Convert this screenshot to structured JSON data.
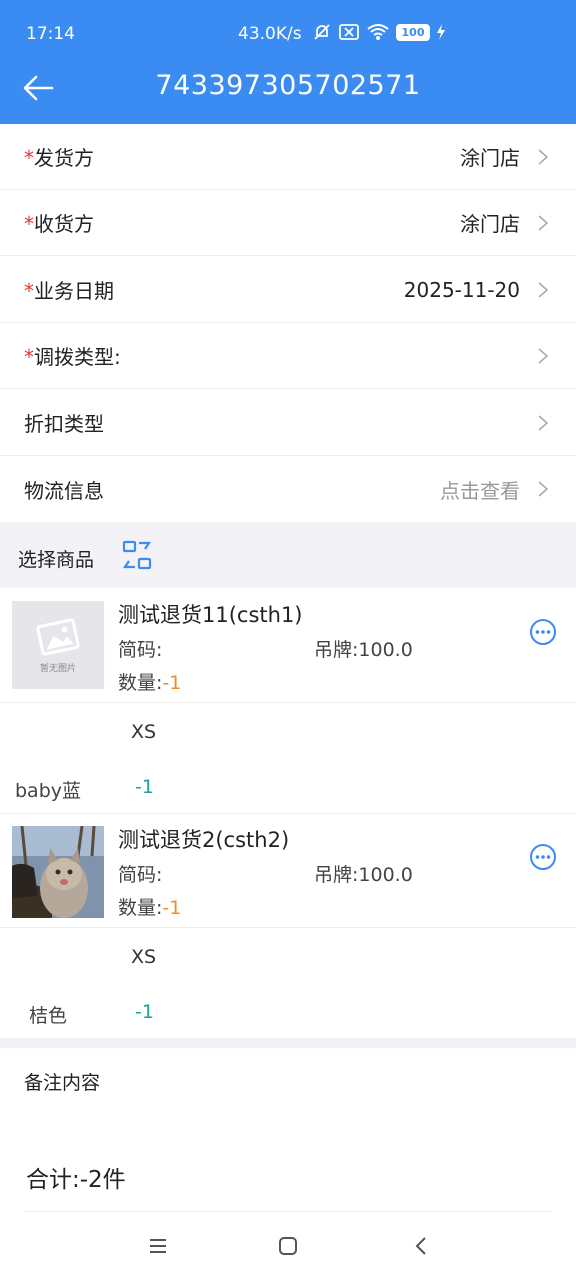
{
  "status_bar": {
    "time": "17:14",
    "net_speed": "43.0K/s",
    "battery": "100"
  },
  "header": {
    "title": "743397305702571"
  },
  "form": {
    "sender": {
      "label": "发货方",
      "value": "涂门店"
    },
    "receiver": {
      "label": "收货方",
      "value": "涂门店"
    },
    "biz_date": {
      "label": "业务日期",
      "value": "2025-11-20"
    },
    "transfer_type": {
      "label": "调拨类型:",
      "value": ""
    },
    "discount_type": {
      "label": "折扣类型",
      "value": ""
    },
    "logistics": {
      "label": "物流信息",
      "value": "点击查看"
    }
  },
  "select_goods": {
    "label": "选择商品"
  },
  "products": [
    {
      "name": "测试退货11(csth1)",
      "code_label": "简码:",
      "tag_label": "吊牌:100.0",
      "qty_label": "数量:",
      "qty": "-1",
      "thumb_text": "暂无图片",
      "size": "XS",
      "color": "baby蓝",
      "color_qty": "-1"
    },
    {
      "name": "测试退货2(csth2)",
      "code_label": "简码:",
      "tag_label": "吊牌:100.0",
      "qty_label": "数量:",
      "qty": "-1",
      "size": "XS",
      "color": "桔色",
      "color_qty": "-1"
    }
  ],
  "remark": {
    "label": "备注内容"
  },
  "total": {
    "text": "合计:-2件"
  },
  "colors": {
    "header_blue": "#3a8cf2",
    "required_red": "#e53935",
    "qty_orange": "#f08a24",
    "teal": "#1aa39a"
  }
}
